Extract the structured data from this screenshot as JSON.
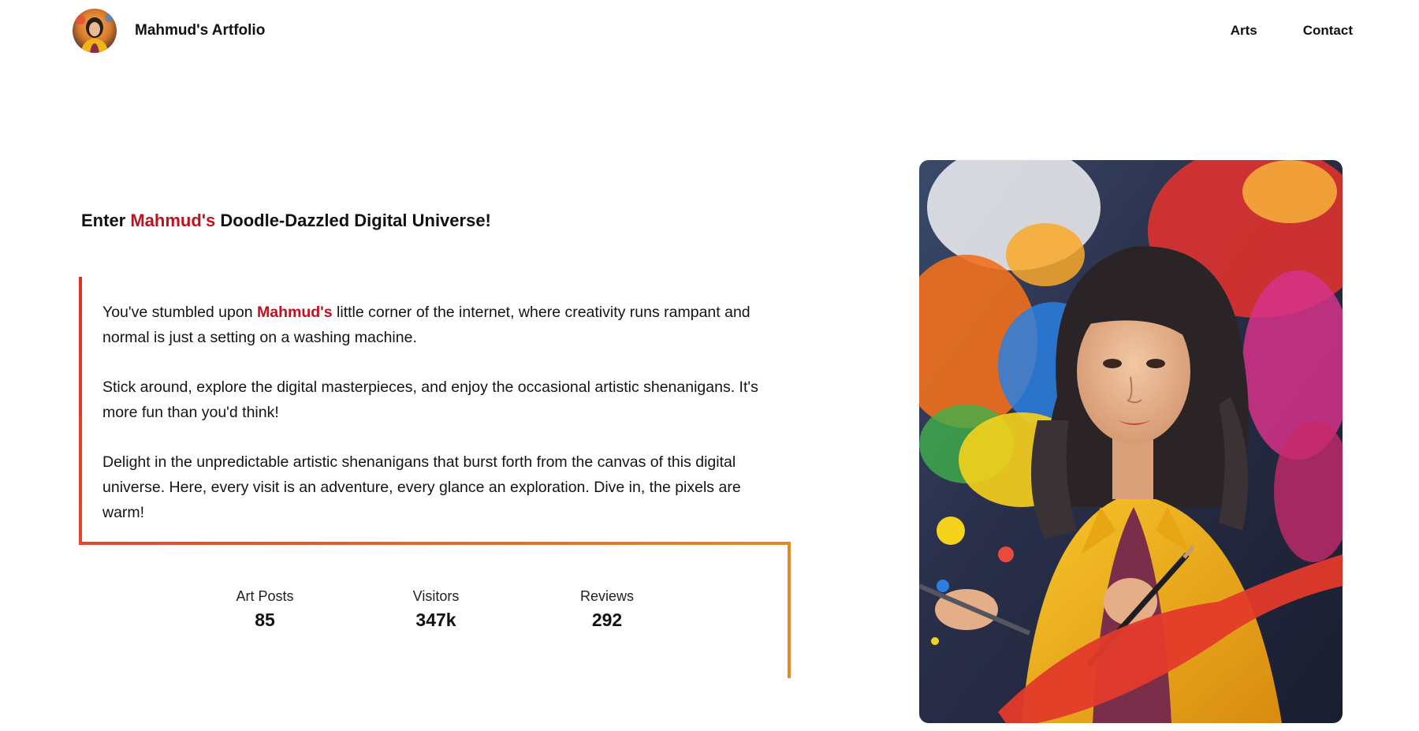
{
  "header": {
    "brand": "Mahmud's Artfolio",
    "nav": [
      {
        "label": "Arts"
      },
      {
        "label": "Contact"
      }
    ]
  },
  "hero": {
    "tagline": {
      "prefix": "Enter ",
      "name": "Mahmud's",
      "middle": " Doodle-Dazzled ",
      "suffix": "Digital Universe!"
    },
    "paragraphs": {
      "p1_before": "You've stumbled upon ",
      "p1_name": "Mahmud's",
      "p1_after": " little corner of the internet, where creativity runs rampant and normal is just a setting on a washing machine.",
      "p2": "Stick around, explore the digital masterpieces, and enjoy the occasional artistic shenanigans. It's more fun than you'd think!",
      "p3": "Delight in the unpredictable artistic shenanigans that burst forth from the canvas of this digital universe. Here, every visit is an adventure, every glance an exploration. Dive in, the pixels are warm!"
    },
    "stats": [
      {
        "label": "Art Posts",
        "value": "85"
      },
      {
        "label": "Visitors",
        "value": "347k"
      },
      {
        "label": "Reviews",
        "value": "292"
      }
    ]
  },
  "colors": {
    "accent": "#c0111f",
    "bracket_start": "#e0302c",
    "bracket_end": "#e48a22"
  }
}
